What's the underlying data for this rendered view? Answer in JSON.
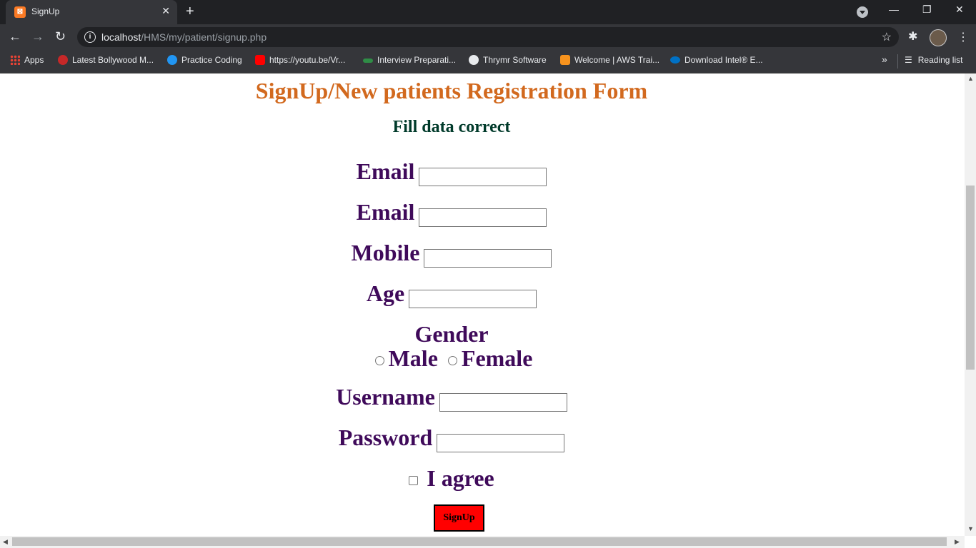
{
  "browser": {
    "tab_title": "SignUp",
    "tab_favicon_text": "⊠",
    "url_host": "localhost",
    "url_path": "/HMS/my/patient/signup.php",
    "bookmarks": [
      {
        "label": "Apps",
        "icon": "apps-grid-icon"
      },
      {
        "label": "Latest Bollywood M...",
        "icon": "m-logo-icon",
        "color": "#c62828"
      },
      {
        "label": "Practice Coding",
        "icon": "pb-logo-icon",
        "color": "#2196f3"
      },
      {
        "label": "https://youtu.be/Vr...",
        "icon": "youtube-icon",
        "color": "#ff0000"
      },
      {
        "label": "Interview Preparati...",
        "icon": "gfg-icon",
        "color": "#2f8d46"
      },
      {
        "label": "Thrymr Software",
        "icon": "globe-icon",
        "color": "#e8eaed"
      },
      {
        "label": "Welcome | AWS Trai...",
        "icon": "aws-icon",
        "color": "#f7931e"
      },
      {
        "label": "Download Intel® E...",
        "icon": "intel-icon",
        "color": "#0071c5"
      }
    ],
    "reading_list": "Reading list"
  },
  "form": {
    "title": "SignUp/New patients Registration Form",
    "subtitle": "Fill data correct",
    "email_label_1": "Email",
    "email_label_2": "Email",
    "mobile_label": "Mobile",
    "age_label": "Age",
    "gender_label": "Gender",
    "male_label": "Male",
    "female_label": "Female",
    "username_label": "Username",
    "password_label": "Password",
    "agree_label": "I agree",
    "submit_label": "SignUp"
  }
}
